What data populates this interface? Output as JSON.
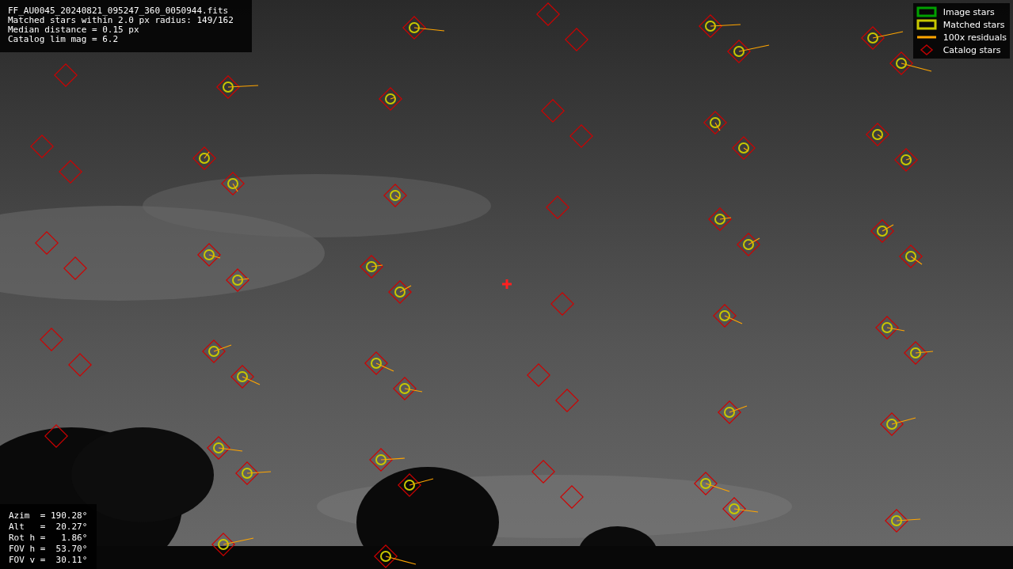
{
  "info": {
    "lines": [
      "FF_AU0045_20240821_095247_360_0050944.fits",
      "Matched stars within 2.0 px radius: 149/162",
      "Median distance = 0.15 px",
      "Catalog lim mag = 6.2"
    ]
  },
  "legend": [
    {
      "kind": "box",
      "color": "#00a000",
      "label": "Image stars"
    },
    {
      "kind": "box",
      "color": "#c8c800",
      "label": "Matched stars"
    },
    {
      "kind": "line",
      "color": "#ffa500",
      "label": "100x residuals"
    },
    {
      "kind": "diamond",
      "color": "#c00000",
      "label": "Catalog stars"
    }
  ],
  "pointing": {
    "lines": [
      "Azim  = 190.28°",
      "Alt   =  20.27°",
      "Rot h =   1.86°",
      "FOV h =  53.70°",
      "FOV v =  30.11°"
    ]
  }
}
